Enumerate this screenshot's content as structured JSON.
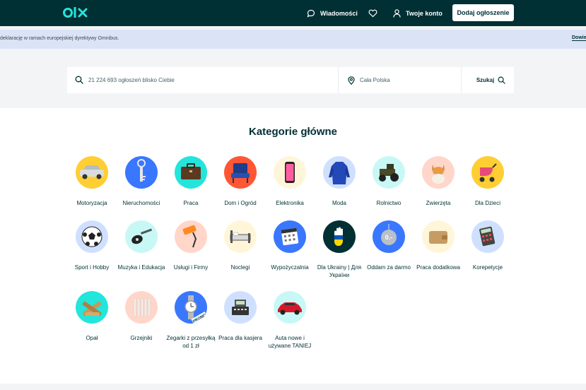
{
  "header": {
    "logo_text": "olx",
    "messages_label": "Wiadomości",
    "account_label": "Twoje konto",
    "add_ad_label": "Dodaj ogłoszenie"
  },
  "banner": {
    "text": "deklarację w ramach europejskiej dyrektywy Omnibus.",
    "link": "Dowie"
  },
  "search": {
    "placeholder": "21 224 693 ogłoszeń blisko Ciebie",
    "location_placeholder": "Cała Polska",
    "button_label": "Szukaj"
  },
  "categories": {
    "title": "Kategorie główne",
    "items": [
      {
        "label": "Motoryzacja",
        "icon": "car-icon",
        "color": "#ffce32"
      },
      {
        "label": "Nieruchomości",
        "icon": "key-icon",
        "color": "#3a77ff"
      },
      {
        "label": "Praca",
        "icon": "briefcase-icon",
        "color": "#23e5db"
      },
      {
        "label": "Dom i Ogród",
        "icon": "armchair-icon",
        "color": "#ff5636"
      },
      {
        "label": "Elektronika",
        "icon": "phone-icon",
        "color": "#fff6d9"
      },
      {
        "label": "Moda",
        "icon": "coat-icon",
        "color": "#cfe0ff"
      },
      {
        "label": "Rolnictwo",
        "icon": "tractor-icon",
        "color": "#c8f8f6"
      },
      {
        "label": "Zwierzęta",
        "icon": "dog-icon",
        "color": "#ffd6c9"
      },
      {
        "label": "Dla Dzieci",
        "icon": "stroller-icon",
        "color": "#ffce32"
      },
      {
        "label": "Sport i Hobby",
        "icon": "football-icon",
        "color": "#cfe0ff"
      },
      {
        "label": "Muzyka i Edukacja",
        "icon": "guitar-icon",
        "color": "#c8f8f6"
      },
      {
        "label": "Usługi i Firmy",
        "icon": "paint-roller-icon",
        "color": "#ffd6c9"
      },
      {
        "label": "Noclegi",
        "icon": "bed-icon",
        "color": "#fff6d9"
      },
      {
        "label": "Wypożyczalnia",
        "icon": "calendar-icon",
        "color": "#3a77ff"
      },
      {
        "label": "Dla Ukrainy | Для України",
        "icon": "ukraine-hand-icon",
        "color": "#002f34"
      },
      {
        "label": "Oddam za darmo",
        "icon": "price-tag-icon",
        "color": "#3a77ff"
      },
      {
        "label": "Praca dodatkowa",
        "icon": "wallet-icon",
        "color": "#fff6d9"
      },
      {
        "label": "Korepetycje",
        "icon": "calculator-icon",
        "color": "#cfe0ff"
      },
      {
        "label": "Opał",
        "icon": "firewood-icon",
        "color": "#23e5db"
      },
      {
        "label": "Grzejniki",
        "icon": "radiator-icon",
        "color": "#ffd6c9"
      },
      {
        "label": "Zegarki z przesyłką od 1 zł",
        "icon": "watch-icon",
        "color": "#3a77ff",
        "badge": "PROMO"
      },
      {
        "label": "Praca dla kasjera",
        "icon": "cash-register-icon",
        "color": "#cfe0ff"
      },
      {
        "label": "Auta nowe i używane TANIEJ",
        "icon": "red-car-icon",
        "color": "#c8f8f6"
      }
    ]
  }
}
